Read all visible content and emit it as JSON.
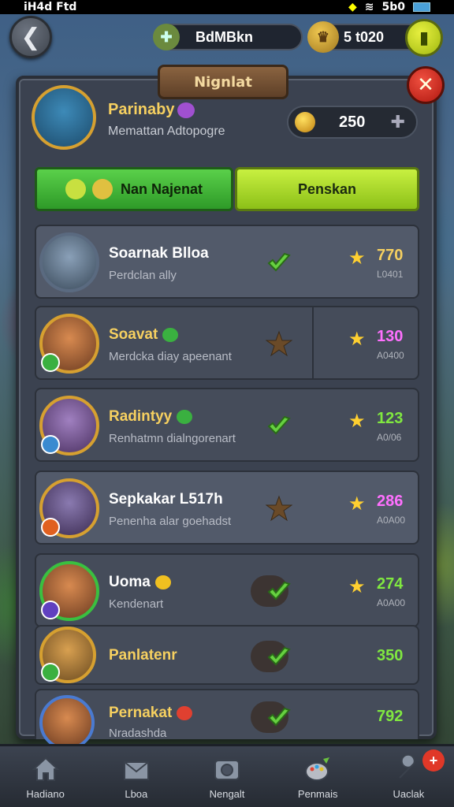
{
  "status_bar": {
    "left": "iH4d Ftd",
    "right": "5b0"
  },
  "top_bar": {
    "player_name": "BdMBkn",
    "gold_amount": "5 t020"
  },
  "panel": {
    "title": "Nignlat",
    "profile": {
      "name": "Parinaby",
      "subtitle": "Memattan Adtopogre",
      "coins": "250"
    },
    "tabs": [
      {
        "label": "Nan Najenat",
        "active": true
      },
      {
        "label": "Penskan",
        "active": false
      }
    ],
    "rows": [
      {
        "name": "Soarnak Blloa",
        "subtitle": "Perdclan ally",
        "score": "770",
        "score_sub": "L0401",
        "action": "green-check"
      },
      {
        "name": "Soavat",
        "subtitle": "Merdcka diay apeenant",
        "score": "130",
        "score_sub": "A0400",
        "action": "brown-star"
      },
      {
        "name": "Radintyy",
        "subtitle": "Renhatmn dialngorenart",
        "score": "123",
        "score_sub": "A0/06",
        "action": "green-check"
      },
      {
        "name": "Sepkakar L517h",
        "subtitle": "Penenha alar goehadst",
        "score": "286",
        "score_sub": "A0A00",
        "action": "brown-star"
      },
      {
        "name": "Uoma",
        "subtitle": "Kendenart",
        "score": "274",
        "score_sub": "A0A00",
        "action": "green-check"
      },
      {
        "name": "Panlatenr",
        "subtitle": "",
        "score": "350",
        "score_sub": "",
        "action": "green-check"
      },
      {
        "name": "Pernakat",
        "subtitle": "Nradashda",
        "score": "792",
        "score_sub": "",
        "action": "green-check"
      }
    ]
  },
  "bottom_nav": [
    {
      "label": "Hadiano",
      "icon": "home-icon"
    },
    {
      "label": "Lboa",
      "icon": "mail-icon"
    },
    {
      "label": "Nengalt",
      "icon": "camera-icon"
    },
    {
      "label": "Penmais",
      "icon": "palette-icon"
    },
    {
      "label": "Uaclak",
      "icon": "wrench-icon",
      "badge": "+"
    }
  ],
  "colors": {
    "accent_green": "#5ad04a",
    "accent_lime": "#c8f040",
    "gold_text": "#f6d060",
    "close_red": "#e03828"
  }
}
